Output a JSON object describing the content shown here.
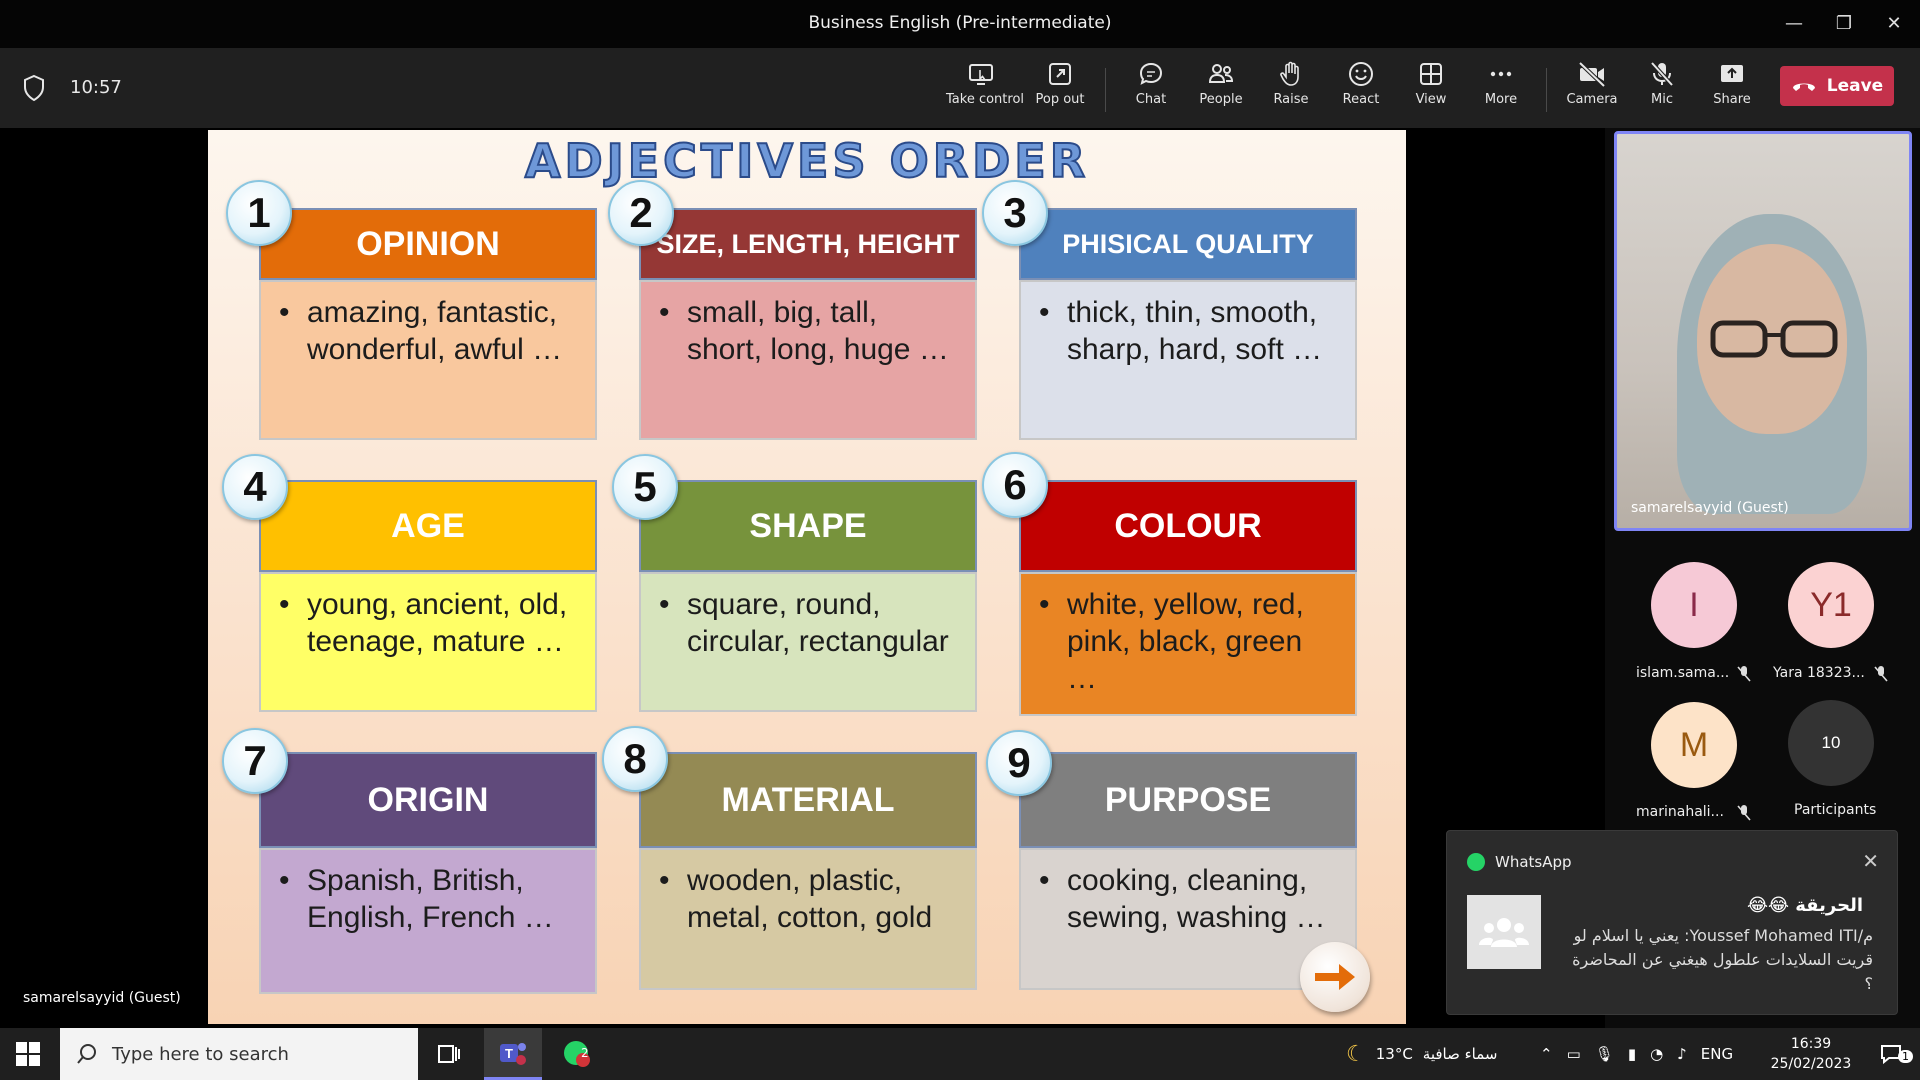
{
  "window": {
    "title": "Business English (Pre-intermediate)",
    "controls": {
      "minimize": "—",
      "restore": "❐",
      "close": "✕"
    }
  },
  "toolbar": {
    "time": "10:57",
    "buttons": [
      {
        "label": "Take control",
        "icon": "take-control-icon"
      },
      {
        "label": "Pop out",
        "icon": "pop-out-icon"
      },
      {
        "label": "Chat",
        "icon": "chat-icon"
      },
      {
        "label": "People",
        "icon": "people-icon"
      },
      {
        "label": "Raise",
        "icon": "raise-hand-icon"
      },
      {
        "label": "React",
        "icon": "react-icon"
      },
      {
        "label": "View",
        "icon": "view-icon"
      },
      {
        "label": "More",
        "icon": "more-icon"
      },
      {
        "label": "Camera",
        "icon": "camera-off-icon"
      },
      {
        "label": "Mic",
        "icon": "mic-off-icon"
      },
      {
        "label": "Share",
        "icon": "share-icon"
      }
    ],
    "leave_label": "Leave",
    "leave_color": "#c4314b"
  },
  "slide": {
    "title": "ADJECTIVES ORDER",
    "cards": [
      {
        "num": "1",
        "head": "OPINION",
        "color": "#e36c09",
        "body_bg": "#f9c89e",
        "items": "amazing, fantastic, wonderful, awful …"
      },
      {
        "num": "2",
        "head": "SIZE, LENGTH, HEIGHT",
        "color": "#953735",
        "body_bg": "#e6a4a4",
        "items": "small, big, tall, short, long, huge …"
      },
      {
        "num": "3",
        "head": "PHISICAL QUALITY",
        "color": "#4f81bd",
        "body_bg": "#dce0ea",
        "items": "thick, thin, smooth, sharp, hard, soft …"
      },
      {
        "num": "4",
        "head": "AGE",
        "color": "#ffc000",
        "body_bg": "#ffff66",
        "items": "young, ancient, old, teenage, mature …"
      },
      {
        "num": "5",
        "head": "SHAPE",
        "color": "#77933c",
        "body_bg": "#d7e4bd",
        "items": "square, round, circular, rectangular"
      },
      {
        "num": "6",
        "head": "COLOUR",
        "color": "#c00000",
        "body_bg": "#e98524",
        "items": "white, yellow, red, pink, black, green …"
      },
      {
        "num": "7",
        "head": "ORIGIN",
        "color": "#604a7b",
        "body_bg": "#c3a8d0",
        "items": "Spanish, British, English, French …"
      },
      {
        "num": "8",
        "head": "MATERIAL",
        "color": "#948a54",
        "body_bg": "#d6c9a3",
        "items": "wooden, plastic, metal, cotton, gold"
      },
      {
        "num": "9",
        "head": "PURPOSE",
        "color": "#7f7f7f",
        "body_bg": "#d9d3cf",
        "items": "cooking, cleaning, sewing, washing …"
      }
    ],
    "presenter": "samarelsayyid (Guest)"
  },
  "participants": {
    "self_name": "samarelsayyid (Guest)",
    "list": [
      {
        "initials": "I",
        "name": "islam.sama...",
        "bg": "#f6c9d6",
        "fg": "#8a2a4a"
      },
      {
        "initials": "Y1",
        "name": "Yara 18323...",
        "bg": "#fbd2d2",
        "fg": "#8a2a2a"
      },
      {
        "initials": "M",
        "name": "marinahali...",
        "bg": "#fde3c8",
        "fg": "#9a5a10"
      }
    ],
    "count": "10",
    "count_label": "Participants"
  },
  "toast": {
    "app": "WhatsApp",
    "group": "الحريقة 😂😂",
    "message": "م/Youssef Mohamed ITI: يعني يا اسلام لو قريت السلايدات علطول هيغني عن المحاضرة ؟"
  },
  "taskbar": {
    "search_placeholder": "Type here to search",
    "weather": "13°C",
    "weather_text": "سماء صافية",
    "lang": "ENG",
    "time": "16:39",
    "date": "25/02/2023",
    "whatsapp_badge": "2",
    "notif_badge": "1"
  }
}
